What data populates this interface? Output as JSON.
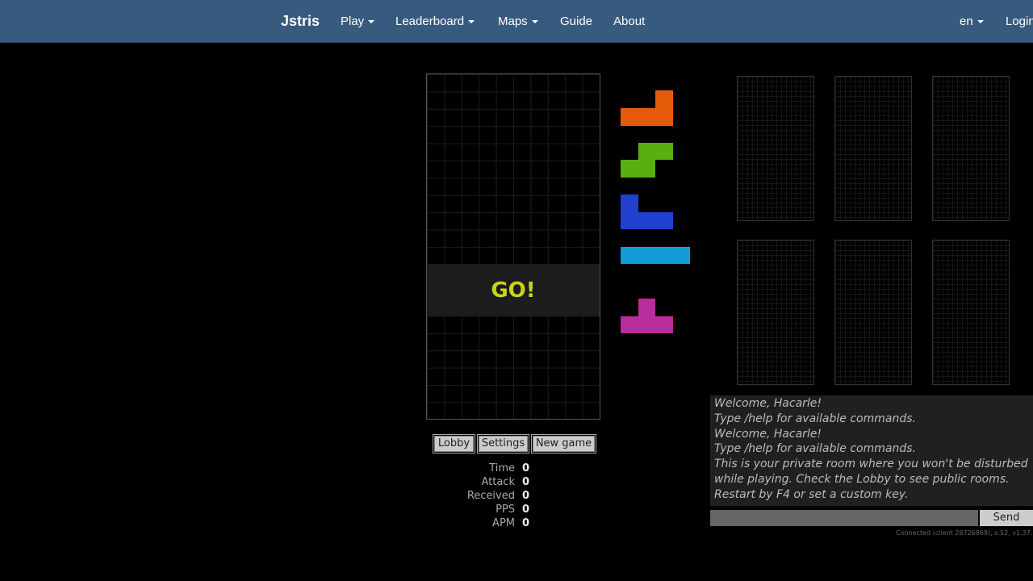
{
  "nav": {
    "brand": "Jstris",
    "play": "Play",
    "leaderboard": "Leaderboard",
    "maps": "Maps",
    "guide": "Guide",
    "about": "About",
    "language": "en",
    "login": "Login"
  },
  "game": {
    "go_text": "GO!",
    "queue": [
      {
        "piece": "L",
        "color": "#e65b0a"
      },
      {
        "piece": "S",
        "color": "#57b00f"
      },
      {
        "piece": "J",
        "color": "#2140cf"
      },
      {
        "piece": "I",
        "color": "#139cd8"
      },
      {
        "piece": "T",
        "color": "#b72d9b"
      }
    ]
  },
  "buttons": {
    "lobby": "Lobby",
    "settings": "Settings",
    "new_game": "New game"
  },
  "stats": [
    {
      "label": "Time",
      "value": "0"
    },
    {
      "label": "Attack",
      "value": "0"
    },
    {
      "label": "Received",
      "value": "0"
    },
    {
      "label": "PPS",
      "value": "0"
    },
    {
      "label": "APM",
      "value": "0"
    }
  ],
  "chat": {
    "lines": [
      "Welcome, Hacarle!",
      "Type /help for available commands.",
      "Welcome, Hacarle!",
      "Type /help for available commands.",
      "This is your private room where you won't be disturbed",
      "while playing. Check the Lobby to see public rooms.",
      "Restart by F4 or set a custom key."
    ],
    "input_value": "",
    "send_label": "Send"
  },
  "status_text": "Connected (client 28726869), s:52, v1.37.25"
}
